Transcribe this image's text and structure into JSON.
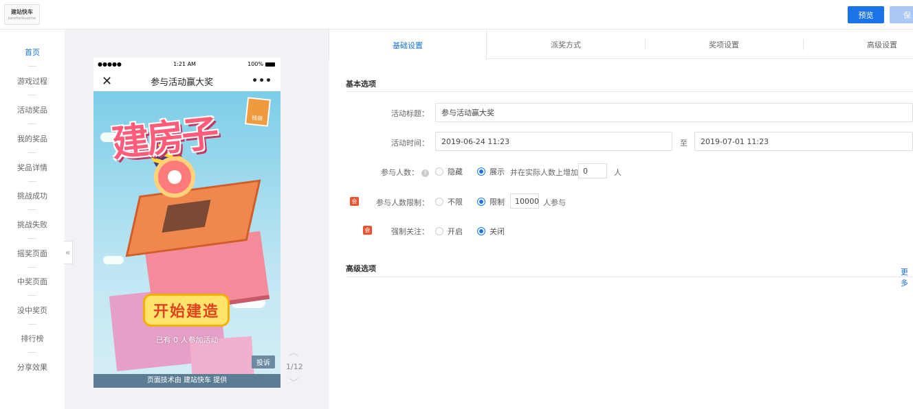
{
  "logo": {
    "line1": "建站快车",
    "line2": "jianzhankuaiche"
  },
  "toolbar": {
    "preview_label": "预览",
    "save_label": "保"
  },
  "sidebar": {
    "items": [
      "首页",
      "游戏过程",
      "活动奖品",
      "我的奖品",
      "奖品详情",
      "挑战成功",
      "挑战失败",
      "摇奖页面",
      "中奖页面",
      "没中奖页",
      "排行榜",
      "分享效果"
    ]
  },
  "collapse_icon": "«",
  "phone": {
    "signal": "●●●●●",
    "time": "1:21 AM",
    "battery": "100%",
    "close_icon": "✕",
    "title": "参与活动赢大奖",
    "more_icon": "•••",
    "game_title": "建房子",
    "tag": "钱袋",
    "start_button": "开始建造",
    "joined_text": "已有 0 人参加活动",
    "report_label": "投诉",
    "footer_text": "页面技术由 建站快车 提供"
  },
  "pager": {
    "up_icon": "︿",
    "page": "1/12",
    "down_icon": "﹀"
  },
  "tabs": [
    "基础设置",
    "派奖方式",
    "奖项设置",
    "高级设置"
  ],
  "basic": {
    "section_title": "基本选项",
    "title_label": "活动标题：",
    "title_value": "参与活动赢大奖",
    "time_label": "活动时间：",
    "start_time": "2019-06-24 11:23",
    "to_label": "至",
    "end_time": "2019-07-01 11:23",
    "participants_label": "参与人数：",
    "participants_hide": "隐藏",
    "participants_show": "展示",
    "participants_add_text": "并在实际人数上增加",
    "participants_add_value": "0",
    "participants_unit": "人",
    "limit_label": "参与人数限制：",
    "limit_none": "不限",
    "limit_on": "限制",
    "limit_value": "10000",
    "limit_unit": "人参与",
    "follow_label": "强制关注：",
    "follow_on": "开启",
    "follow_off": "关闭",
    "vip_badge": "会"
  },
  "advanced": {
    "section_title": "高级选项",
    "more_link": "更多"
  }
}
